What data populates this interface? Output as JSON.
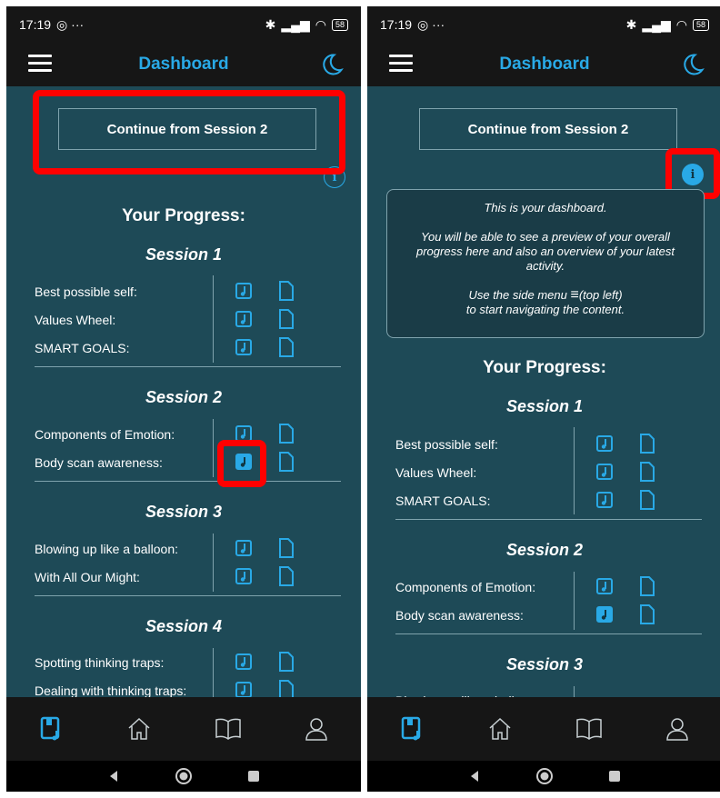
{
  "status": {
    "time": "17:19",
    "battery": "58"
  },
  "appbar": {
    "title": "Dashboard"
  },
  "continue_label": "Continue from Session 2",
  "progress_title": "Your Progress:",
  "info_card": {
    "line1": "This is your dashboard.",
    "line2": "You will be able to see a preview of your overall progress here and also an overview of your latest activity.",
    "line3a": "Use the side menu",
    "line3b": "(top left)",
    "line4": "to start navigating the content."
  },
  "sessions": [
    {
      "title": "Session 1",
      "activities": [
        "Best possible self:",
        "Values Wheel:",
        "SMART GOALS:"
      ]
    },
    {
      "title": "Session 2",
      "activities": [
        "Components of Emotion:",
        "Body scan awareness:"
      ]
    },
    {
      "title": "Session 3",
      "activities": [
        "Blowing up like a balloon:",
        "With All Our Might:"
      ]
    },
    {
      "title": "Session 4",
      "activities": [
        "Spotting thinking traps:",
        "Dealing with thinking traps:"
      ]
    }
  ],
  "completed_audio": "Body scan awareness",
  "nav": [
    "modules-icon",
    "home-icon",
    "book-icon",
    "profile-icon"
  ],
  "colors": {
    "accent": "#29a9e6",
    "background": "#1e4a57",
    "bar": "#161616",
    "highlight": "#ff0000"
  }
}
